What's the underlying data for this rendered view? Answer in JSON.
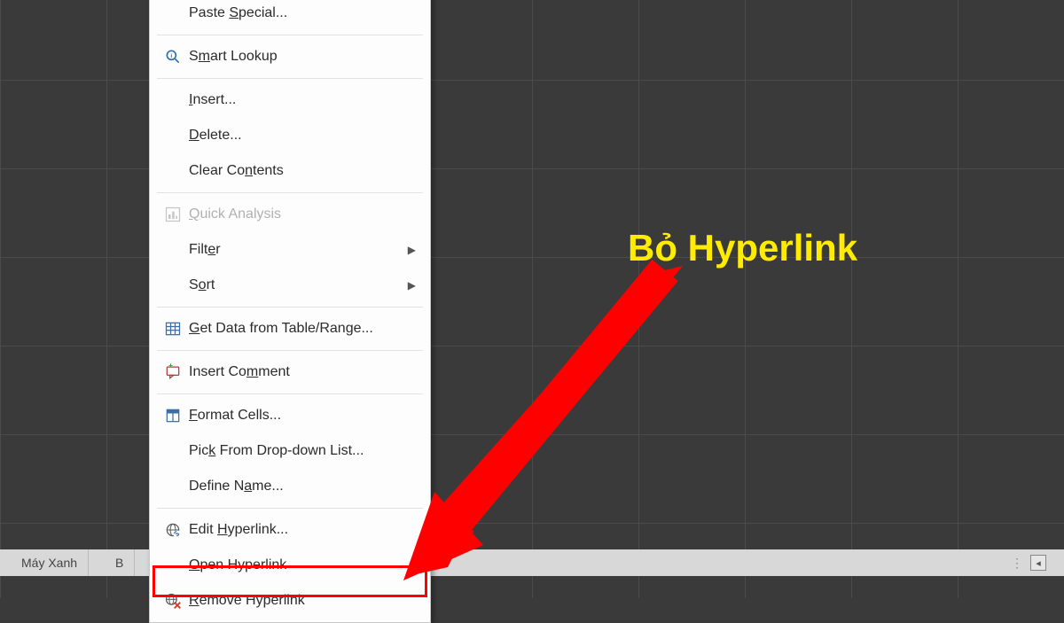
{
  "callout_text": "Bỏ Hyperlink",
  "sheet_tabs": [
    "Máy Xanh",
    "B"
  ],
  "menu": {
    "items": [
      {
        "pre": "Paste ",
        "ul": "S",
        "post": "pecial...",
        "icon": "none",
        "submenu": false,
        "disabled": false
      },
      {
        "pre": "S",
        "ul": "m",
        "post": "art Lookup",
        "icon": "smart-lookup-icon",
        "submenu": false,
        "disabled": false,
        "sep_before": true
      },
      {
        "pre": "",
        "ul": "I",
        "post": "nsert...",
        "icon": "none",
        "submenu": false,
        "disabled": false,
        "sep_before": true
      },
      {
        "pre": "",
        "ul": "D",
        "post": "elete...",
        "icon": "none",
        "submenu": false,
        "disabled": false
      },
      {
        "pre": "Clear Co",
        "ul": "n",
        "post": "tents",
        "icon": "none",
        "submenu": false,
        "disabled": false
      },
      {
        "pre": "",
        "ul": "Q",
        "post": "uick Analysis",
        "icon": "quick-analysis-icon",
        "submenu": false,
        "disabled": true,
        "sep_before": true
      },
      {
        "pre": "Filt",
        "ul": "e",
        "post": "r",
        "icon": "none",
        "submenu": true,
        "disabled": false
      },
      {
        "pre": "S",
        "ul": "o",
        "post": "rt",
        "icon": "none",
        "submenu": true,
        "disabled": false
      },
      {
        "pre": "",
        "ul": "G",
        "post": "et Data from Table/Range...",
        "icon": "table-icon",
        "submenu": false,
        "disabled": false,
        "sep_before": true
      },
      {
        "pre": "Insert Co",
        "ul": "m",
        "post": "ment",
        "icon": "comment-icon",
        "submenu": false,
        "disabled": false,
        "sep_before": true
      },
      {
        "pre": "",
        "ul": "F",
        "post": "ormat Cells...",
        "icon": "format-cells-icon",
        "submenu": false,
        "disabled": false,
        "sep_before": true
      },
      {
        "pre": "Pic",
        "ul": "k",
        "post": " From Drop-down List...",
        "icon": "none",
        "submenu": false,
        "disabled": false
      },
      {
        "pre": "Define N",
        "ul": "a",
        "post": "me...",
        "icon": "none",
        "submenu": false,
        "disabled": false
      },
      {
        "pre": "Edit ",
        "ul": "H",
        "post": "yperlink...",
        "icon": "hyperlink-icon",
        "submenu": false,
        "disabled": false,
        "sep_before": true
      },
      {
        "pre": "",
        "ul": "O",
        "post": "pen Hyperlink",
        "icon": "none",
        "submenu": false,
        "disabled": false
      },
      {
        "pre": "",
        "ul": "R",
        "post": "emove Hyperlink",
        "icon": "remove-hyperlink-icon",
        "submenu": false,
        "disabled": false
      }
    ]
  }
}
